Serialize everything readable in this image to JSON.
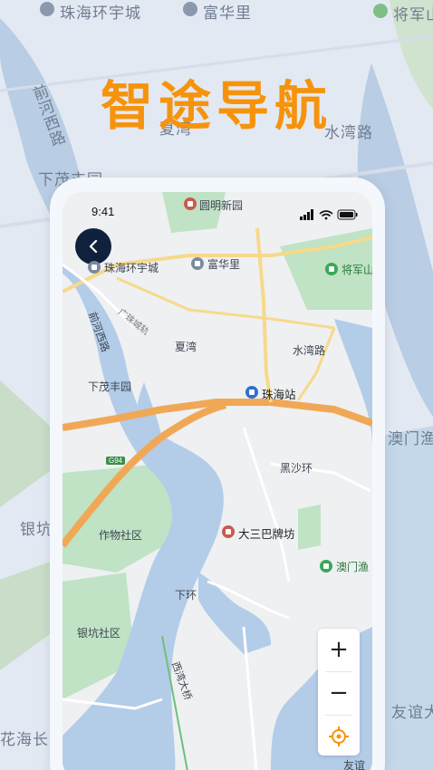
{
  "headline": "智途导航",
  "background_map": {
    "labels": {
      "zhuhai_huanyu": "珠海环宇城",
      "fuhua": "富华里",
      "jiangjun": "将军山",
      "qianhe_xilu": "前河西路",
      "xiamao": "下茂丰园",
      "xiawan": "夏湾",
      "shuiwan_road": "水湾路",
      "macau_fishing": "澳门渔",
      "yinkeng": "银坑",
      "huahai": "花海长",
      "youyi": "友谊大"
    }
  },
  "phone": {
    "status_bar": {
      "time": "9:41"
    },
    "map_labels": {
      "yuanming": "圆明新园",
      "zhuhai_huanyu": "珠海环宇城",
      "fuhua": "富华里",
      "jiangjun": "将军山",
      "road_diagonal": "广珠城轨",
      "qianhe_xilu": "前河西路",
      "xiawan": "夏湾",
      "shuiwan_road": "水湾路",
      "xiamao": "下茂丰园",
      "zhuhai_station": "珠海站",
      "g94": "G94",
      "heishahuan": "黑沙环",
      "zuowu": "作物社区",
      "dasanba": "大三巴牌坊",
      "macau_fishing": "澳门渔",
      "xiahuan": "下环",
      "yinkeng": "银坑社区",
      "xiwan_bridge": "西湾大桥",
      "youyi": "友谊"
    },
    "controls": {
      "zoom_in": "+",
      "zoom_out": "−"
    }
  }
}
